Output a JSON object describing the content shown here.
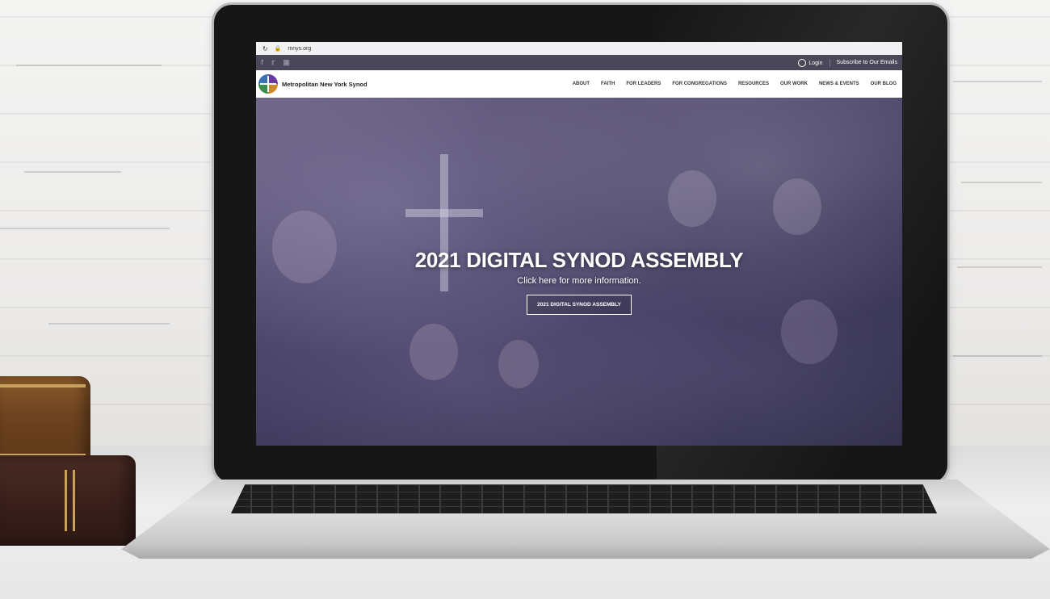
{
  "browser": {
    "reload_icon": "reload-icon",
    "lock_icon": "lock-icon",
    "url": "mnys.org"
  },
  "topbar": {
    "social_icons": [
      "facebook-icon",
      "twitter-icon",
      "instagram-icon"
    ],
    "login_label": "Login",
    "subscribe_label": "Subscribe to Our Emails"
  },
  "header": {
    "site_name": "Metropolitan New York Synod",
    "menu": [
      "ABOUT",
      "FAITH",
      "FOR LEADERS",
      "FOR CONGREGATIONS",
      "RESOURCES",
      "OUR WORK",
      "NEWS & EVENTS",
      "OUR BLOG"
    ]
  },
  "hero": {
    "title": "2021 DIGITAL SYNOD ASSEMBLY",
    "subtitle": "Click here for more information.",
    "button_label": "2021 DIGITAL SYNOD ASSEMBLY"
  },
  "colors": {
    "topbar_bg": "#4a4858",
    "hero_tint": "#3a3658",
    "nav_bg": "#ffffff"
  }
}
